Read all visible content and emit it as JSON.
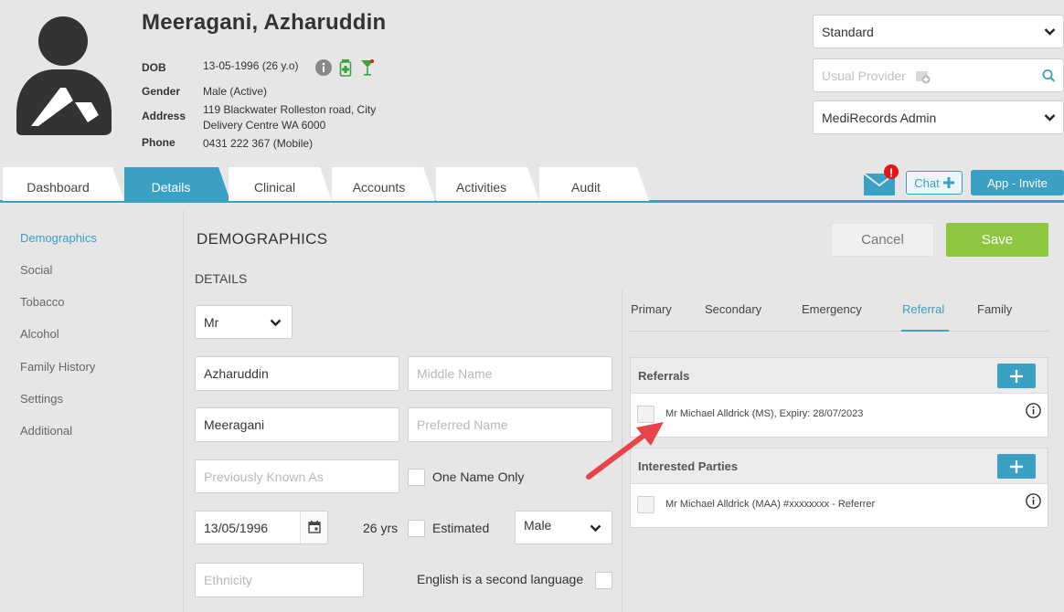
{
  "patient": {
    "name": "Meeragani, Azharuddin",
    "dob_label": "DOB",
    "dob": "13-05-1996 (26 y.o)",
    "gender_label": "Gender",
    "gender": "Male (Active)",
    "address_label": "Address",
    "address_line1": "119 Blackwater Rolleston road, City",
    "address_line2": "Delivery Centre WA 6000",
    "phone_label": "Phone",
    "phone": "0431 222 367 (Mobile)"
  },
  "header_controls": {
    "type_select": "Standard",
    "provider_placeholder": "Usual Provider",
    "practice_select": "MediRecords Admin"
  },
  "tabs": [
    {
      "label": "Dashboard"
    },
    {
      "label": "Details"
    },
    {
      "label": "Clinical"
    },
    {
      "label": "Accounts"
    },
    {
      "label": "Activities"
    },
    {
      "label": "Audit"
    }
  ],
  "active_tab": "Details",
  "toolbar": {
    "chat_label": "Chat",
    "app_invite_label": "App - Invite",
    "mail_alert": "!"
  },
  "sidebar": {
    "items": [
      {
        "label": "Demographics"
      },
      {
        "label": "Social"
      },
      {
        "label": "Tobacco"
      },
      {
        "label": "Alcohol"
      },
      {
        "label": "Family History"
      },
      {
        "label": "Settings"
      },
      {
        "label": "Additional"
      }
    ],
    "active": "Demographics"
  },
  "main": {
    "title": "DEMOGRAPHICS",
    "section": "DETAILS",
    "cancel_label": "Cancel",
    "save_label": "Save"
  },
  "form": {
    "title_value": "Mr",
    "first_name": "Azharuddin",
    "middle_name_placeholder": "Middle Name",
    "last_name": "Meeragani",
    "preferred_name_placeholder": "Preferred Name",
    "previously_known_placeholder": "Previously Known As",
    "one_name_only_label": "One Name Only",
    "dob_value": "13/05/1996",
    "age_text": "26 yrs",
    "estimated_label": "Estimated",
    "sex_value": "Male",
    "ethnicity_placeholder": "Ethnicity",
    "english_second_label": "English is a second language"
  },
  "contact_tabs": [
    {
      "label": "Primary"
    },
    {
      "label": "Secondary"
    },
    {
      "label": "Emergency"
    },
    {
      "label": "Referral"
    },
    {
      "label": "Family"
    }
  ],
  "contact_tab_active": "Referral",
  "referrals": {
    "title": "Referrals",
    "items": [
      {
        "text": "Mr Michael Alldrick (MS), Expiry: 28/07/2023"
      }
    ]
  },
  "interested_parties": {
    "title": "Interested Parties",
    "items": [
      {
        "text": "Mr Michael Alldrick (MAA) #xxxxxxxx - Referrer"
      }
    ]
  },
  "colors": {
    "accent": "#3aa0c4",
    "save": "#8dc63f",
    "alert": "#e8141b",
    "annotation_arrow": "#e8424b"
  },
  "icons": [
    "avatar-icon",
    "info-icon",
    "medication-icon",
    "alcohol-icon",
    "chevron-down-icon",
    "search-icon",
    "mail-icon",
    "plus-icon",
    "calendar-icon"
  ]
}
